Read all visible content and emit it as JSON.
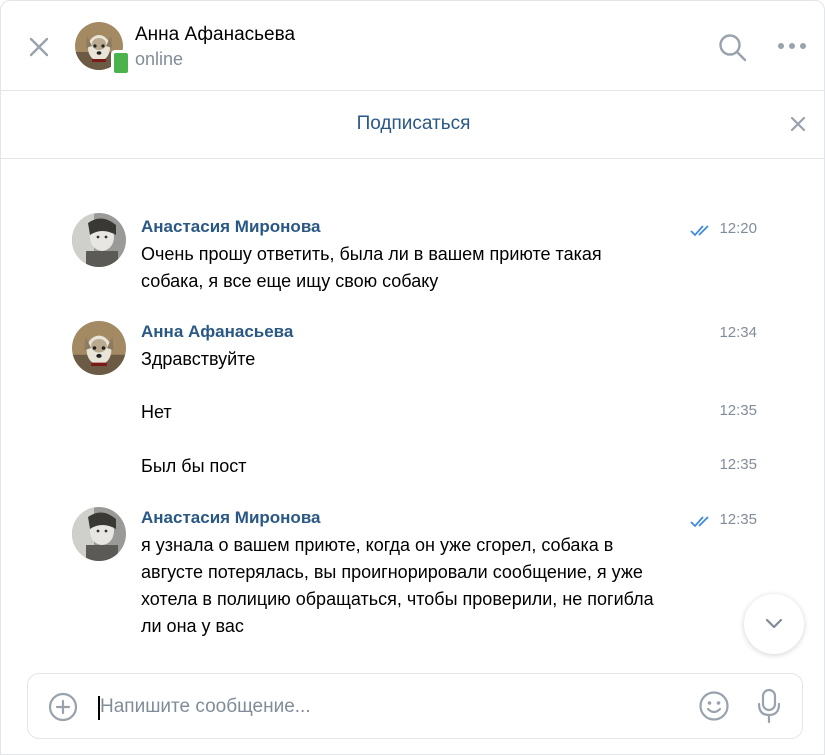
{
  "header": {
    "name": "Анна Афанасьева",
    "status": "online",
    "status_device": "mobile-icon",
    "icons": {
      "close": "close-icon",
      "search": "search-icon",
      "more": "more-icon"
    }
  },
  "subscribe_bar": {
    "label": "Подписаться",
    "close_icon": "close-icon"
  },
  "messages": [
    {
      "author": "Анастасия Миронова",
      "time": "12:20",
      "read": true,
      "text": "Очень прошу ответить, была ли в вашем приюте такая собака, я все еще ищу свою собаку"
    },
    {
      "author": "Анна Афанасьева",
      "time": "12:34",
      "read": false,
      "text": "Здравствуйте"
    },
    {
      "author": "",
      "time": "12:35",
      "read": false,
      "text": "Нет"
    },
    {
      "author": "",
      "time": "12:35",
      "read": false,
      "text": "Был бы пост"
    },
    {
      "author": "Анастасия Миронова",
      "time": "12:35",
      "read": true,
      "text": "я узнала о вашем приюте, когда он уже сгорел, собака в августе потерялась, вы проигнорировали сообщение, я уже хотела в полицию обращаться, чтобы проверили, не погибла ли она у вас"
    }
  ],
  "composer": {
    "placeholder": "Напишите сообщение...",
    "value": "",
    "icons": {
      "attach": "plus-circle-icon",
      "emoji": "smile-icon",
      "voice": "microphone-icon"
    }
  },
  "colors": {
    "link": "#2a5885",
    "secondary_text": "#818c99",
    "read_check": "#3f8ae0",
    "online_green": "#4bb34b",
    "border": "#e3e5e8"
  }
}
